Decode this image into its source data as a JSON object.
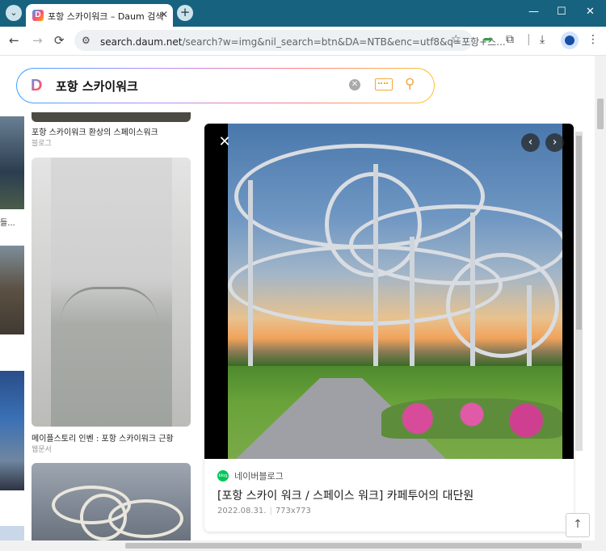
{
  "browser": {
    "tab_title": "포항 스카이워크 – Daum 검색",
    "favicon_letter": "D",
    "tab_close": "✕",
    "new_tab": "+",
    "url_host": "search.daum.net",
    "url_rest": "/search?w=img&nil_search=btn&DA=NTB&enc=utf8&q=포항+스...",
    "back_icon": "←",
    "forward_icon": "→",
    "reload_icon": "⟳",
    "minimize": "—",
    "maximize": "☐",
    "close": "✕"
  },
  "search": {
    "logo": "D",
    "query": "포항 스카이워크"
  },
  "results": {
    "left_caption": "들...",
    "card1_title": "포항 스카이워크 환상의 스페이스워크",
    "card1_source": "블로그",
    "card2_title": "메이플스토리 인벤 : 포항 스카이워크 근황",
    "card2_source": "웹문서"
  },
  "detail": {
    "source_badge": "blog",
    "source_name": "네이버블로그",
    "title": "[포항 스카이 워크 / 스페이스 워크] 카페투어의 대단원",
    "date": "2022.08.31.",
    "size": "773x773",
    "close_icon": "✕",
    "prev_icon": "‹",
    "next_icon": "›"
  },
  "scroll_top_icon": "↑",
  "colors": {
    "titlebar": "#17627f",
    "accent_search": "#f2a93b",
    "naver_green": "#03c75a"
  }
}
